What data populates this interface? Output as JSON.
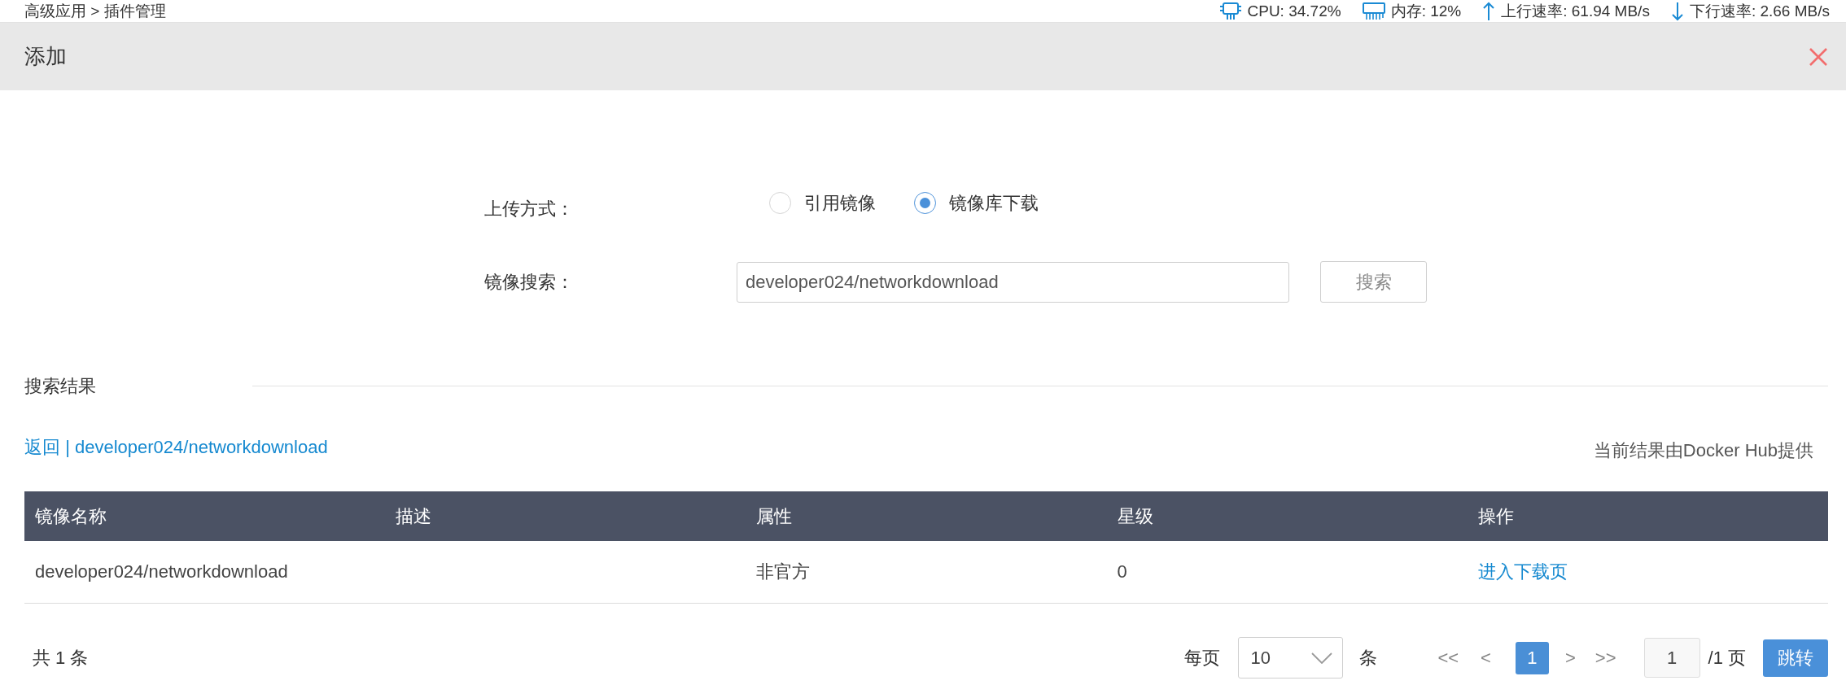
{
  "top_bar": {
    "breadcrumb": "高级应用 > 插件管理",
    "stats": [
      {
        "kind": "cpu",
        "text": "CPU: 34.72%"
      },
      {
        "kind": "memory",
        "text": "内存: 12%"
      },
      {
        "kind": "upload",
        "text": "上行速率: 61.94 MB/s"
      },
      {
        "kind": "download",
        "text": "下行速率: 2.66 MB/s"
      }
    ]
  },
  "dialog": {
    "title": "添加"
  },
  "form": {
    "upload_method": {
      "label": "上传方式：",
      "options": [
        {
          "label": "引用镜像",
          "selected": false
        },
        {
          "label": "镜像库下载",
          "selected": true
        }
      ]
    },
    "image_search": {
      "label": "镜像搜索：",
      "value": "developer024/networkdownload",
      "button": "搜索"
    }
  },
  "results": {
    "title": "搜索结果",
    "back_link": "返回",
    "separator": "|",
    "query": "developer024/networkdownload",
    "source_note": "当前结果由Docker Hub提供"
  },
  "table": {
    "columns": [
      "镜像名称",
      "描述",
      "属性",
      "星级",
      "操作"
    ],
    "rows": [
      {
        "image_name": "developer024/networkdownload",
        "attribute": "非官方",
        "rating": "0",
        "action": "进入下载页"
      }
    ]
  },
  "pagination": {
    "total": "共 1 条",
    "per_page_label": "每页",
    "per_page": "10",
    "per_page_unit": "条",
    "first": "<<",
    "prev": "<",
    "pages": [
      {
        "label": "1",
        "selected": true
      }
    ],
    "next": ">",
    "last": ">>",
    "page_input": "1",
    "page_total": "/1 页",
    "jump": "跳转"
  }
}
